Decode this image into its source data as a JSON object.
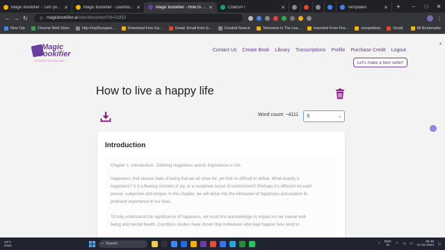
{
  "browser": {
    "tabs": [
      {
        "label": "Magic Bookifier - Turn your ide",
        "color": "#f4b400",
        "active": false
      },
      {
        "label": "Magic Bookifier - Dashboard",
        "color": "#f4b400",
        "active": false
      },
      {
        "label": "Magic Bookifier - How to live a",
        "color": "#6b3fa0",
        "active": true
      },
      {
        "label": "ChatGPT",
        "color": "#10a37f",
        "active": false
      },
      {
        "label": "",
        "color": "#888888",
        "active": false
      },
      {
        "label": "",
        "color": "#ea4335",
        "active": false
      },
      {
        "label": "",
        "color": "#888888",
        "active": false
      },
      {
        "label": "",
        "color": "#4285f4",
        "active": false
      },
      {
        "label": "Templates",
        "color": "#4285f4",
        "active": false
      }
    ],
    "url_host": "magicbookifier.ai",
    "url_path": "/user/document?id=21853",
    "bookmarks": [
      {
        "label": "New Tab",
        "color": "#4285f4"
      },
      {
        "label": "Chrome Web Store",
        "color": "#34a853"
      },
      {
        "label": "http://mp3hungam...",
        "color": "#888888"
      },
      {
        "label": "Download Free Ga...",
        "color": "#f4b400"
      },
      {
        "label": "Gmail: Email from G...",
        "color": "#ea4335"
      },
      {
        "label": "Conduit Search",
        "color": "#888888"
      },
      {
        "label": "Television Is The Lea...",
        "color": "#f4b400"
      },
      {
        "label": "Imported From Fire...",
        "color": "#f4b400"
      },
      {
        "label": "competitors",
        "color": "#f4b400"
      },
      {
        "label": "Gmail",
        "color": "#ea4335"
      }
    ],
    "all_bookmarks": "All Bookmarks"
  },
  "site": {
    "logo": {
      "line1": "Magic",
      "line2": "Bookifier",
      "tagline": "A STORY TELLING APP"
    },
    "nav": [
      "Contact Us",
      "Create Book",
      "Library",
      "Transcriptions",
      "Profile",
      "Purchase Credit",
      "Logout"
    ],
    "cta": "Let's make a best seller!",
    "title": "How to live a happy life",
    "word_count_label": "Word count: ~4111",
    "select_value": "3",
    "section_heading": "Introduction",
    "chapter_line": "Chapter 1: Introduction - Defining Happiness and its Importance in Life",
    "paragraph1": [
      "Happiness, that elusive state of being that we all strive for, yet find so difficult to define. What exactly is",
      "happiness? Is it a fleeting moment of joy, or a sustained sense of contentment? Perhaps it's different for each",
      "person, subjective and unique. In this chapter, we will delve into the intricacies of happiness and explore its",
      "profound importance in our lives."
    ],
    "paragraph2": [
      "To truly understand the significance of happiness, we must first acknowledge its impact on our overall well-",
      "being and mental health. Countless studies have shown that individuals who lead happier lives tend to"
    ],
    "colors": {
      "accent": "#6b3fa0",
      "trash": "#8e1b8a",
      "float": "#8e88e0"
    }
  },
  "taskbar": {
    "weather_temp": "19°C",
    "weather_desc": "Haze",
    "search": "Search",
    "apps": [
      "#f2c94c",
      "#333333",
      "#4285f4",
      "#1f6feb",
      "#ffb000",
      "#6b3fa0",
      "#e04e39",
      "#3a6ff7",
      "#29a3e0",
      "#2d8c3c",
      "#22c55e"
    ],
    "lang1": "ENG",
    "lang2": "IN",
    "time": "09:46",
    "date": "27-02-2024"
  }
}
